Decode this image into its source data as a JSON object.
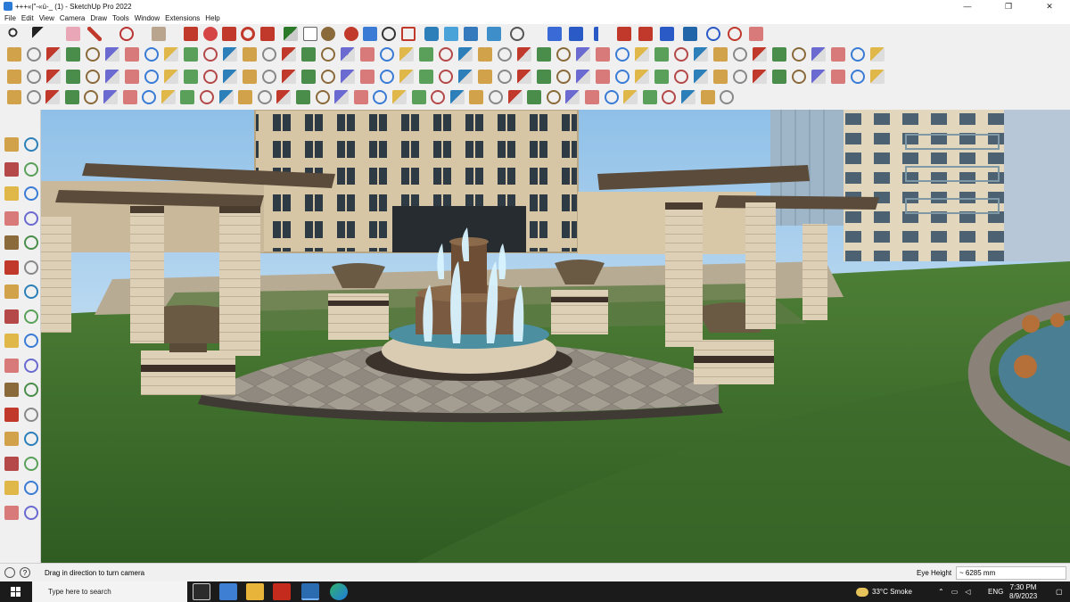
{
  "window": {
    "title": "+++«|\"-«ú-_ (1) - SketchUp Pro 2022",
    "minimize": "—",
    "maximize": "❐",
    "close": "✕"
  },
  "menu": [
    "File",
    "Edit",
    "View",
    "Camera",
    "Draw",
    "Tools",
    "Window",
    "Extensions",
    "Help"
  ],
  "status": {
    "info_icon": "?",
    "message": "Drag in direction to turn camera",
    "vcb_label": "Eye Height",
    "vcb_value": "~ 6285 mm"
  },
  "taskbar": {
    "search_placeholder": "Type here to search",
    "weather": "33°C  Smoke",
    "language": "ENG",
    "time": "7:30 PM",
    "date": "8/9/2023"
  },
  "colors": {
    "sky": "#9ec8ea",
    "grass": "#3d6e2e",
    "paving": "#9b9488",
    "stone": "#d9ccb2",
    "water": "#5fb8c8"
  }
}
